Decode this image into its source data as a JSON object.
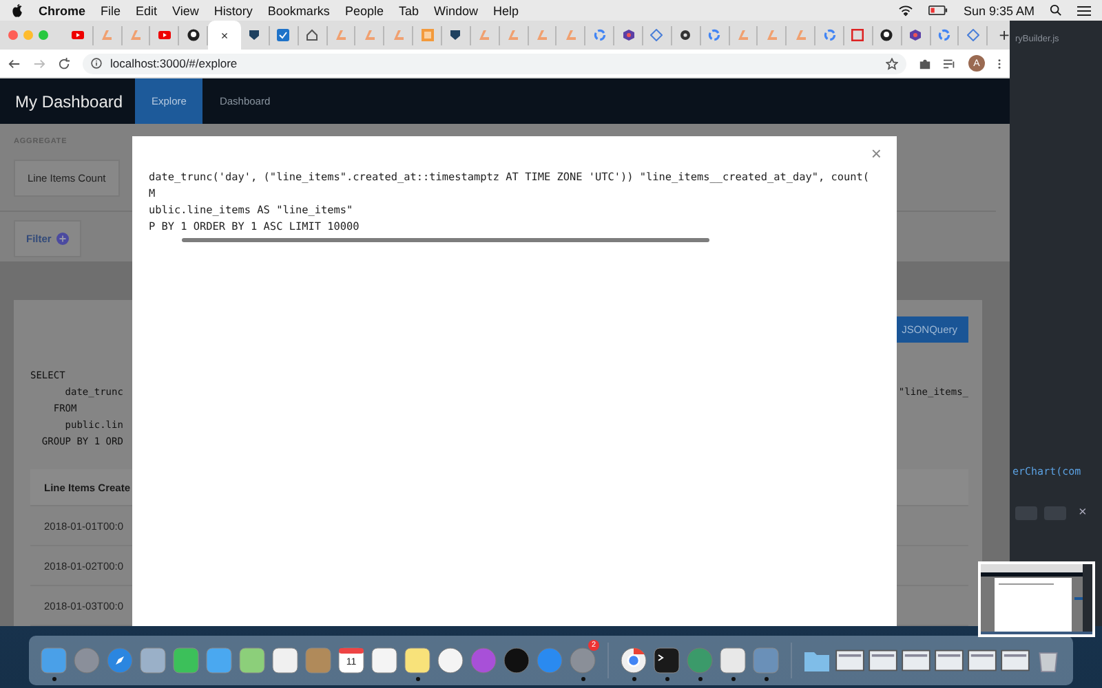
{
  "menu_bar": {
    "app": "Chrome",
    "menus": [
      "File",
      "Edit",
      "View",
      "History",
      "Bookmarks",
      "People",
      "Tab",
      "Window",
      "Help"
    ],
    "clock": "Sun 9:35 AM"
  },
  "browser": {
    "tabs": [
      {
        "kind": "youtube",
        "selected": false
      },
      {
        "kind": "orange",
        "selected": false
      },
      {
        "kind": "orange",
        "selected": false
      },
      {
        "kind": "youtube",
        "selected": false
      },
      {
        "kind": "github",
        "selected": false
      },
      {
        "kind": "blank",
        "selected": true
      },
      {
        "kind": "shield",
        "selected": false
      },
      {
        "kind": "check",
        "selected": false
      },
      {
        "kind": "home",
        "selected": false
      },
      {
        "kind": "orange",
        "selected": false
      },
      {
        "kind": "orange",
        "selected": false
      },
      {
        "kind": "orange",
        "selected": false
      },
      {
        "kind": "grid",
        "selected": false
      },
      {
        "kind": "shield",
        "selected": false
      },
      {
        "kind": "orange",
        "selected": false
      },
      {
        "kind": "orange",
        "selected": false
      },
      {
        "kind": "orange",
        "selected": false
      },
      {
        "kind": "orange",
        "selected": false
      },
      {
        "kind": "google",
        "selected": false
      },
      {
        "kind": "hex",
        "selected": false
      },
      {
        "kind": "diamond",
        "selected": false
      },
      {
        "kind": "gear",
        "selected": false
      },
      {
        "kind": "google",
        "selected": false
      },
      {
        "kind": "orange",
        "selected": false
      },
      {
        "kind": "orange",
        "selected": false
      },
      {
        "kind": "orange",
        "selected": false
      },
      {
        "kind": "google",
        "selected": false
      },
      {
        "kind": "red",
        "selected": false
      },
      {
        "kind": "github",
        "selected": false
      },
      {
        "kind": "hex",
        "selected": false
      },
      {
        "kind": "google",
        "selected": false
      },
      {
        "kind": "diamond",
        "selected": false
      }
    ],
    "tab_close": "×",
    "new_tab": "+",
    "address": "localhost:3000/#/explore",
    "profile_initial": "A"
  },
  "page": {
    "brand": "My Dashboard",
    "nav": [
      {
        "label": "Explore",
        "selected": true
      },
      {
        "label": "Dashboard",
        "selected": false
      }
    ],
    "aggregate_heading": "AGGREGATE",
    "measure_button": "Line Items Count",
    "filter_button": "Filter",
    "query_button": "JSONQuery",
    "sql_lines": [
      "SELECT",
      "      date_trunc",
      "    FROM",
      "      public.lin",
      "  GROUP BY 1 ORD"
    ],
    "sql_right": "\"line_items_",
    "table": {
      "column": "Line Items Create",
      "rows": [
        "2018-01-01T00:0",
        "2018-01-02T00:0",
        "2018-01-03T00:0"
      ]
    }
  },
  "modal": {
    "lines": [
      "date_trunc('day', (\"line_items\".created_at::timestamptz AT TIME ZONE 'UTC')) \"line_items__created_at_day\", count(",
      "M",
      "ublic.line_items AS \"line_items\"",
      "P BY 1 ORDER BY 1 ASC LIMIT 10000"
    ],
    "close": "×"
  },
  "editor": {
    "tab_title": "ryBuilder.js",
    "code": "erChart(com",
    "close": "×"
  },
  "dock": {
    "items": [
      {
        "kind": "finder",
        "running": true
      },
      {
        "kind": "launchpad",
        "running": false
      },
      {
        "kind": "safari",
        "running": false
      },
      {
        "kind": "mail",
        "running": false
      },
      {
        "kind": "facetime",
        "running": false
      },
      {
        "kind": "messages",
        "running": false
      },
      {
        "kind": "maps",
        "running": false
      },
      {
        "kind": "photos",
        "running": false
      },
      {
        "kind": "contacts",
        "running": false
      },
      {
        "kind": "calendar",
        "running": false,
        "label": "11"
      },
      {
        "kind": "reminders",
        "running": false
      },
      {
        "kind": "notes",
        "running": true
      },
      {
        "kind": "music",
        "running": false
      },
      {
        "kind": "podcasts",
        "running": false
      },
      {
        "kind": "tv",
        "running": false
      },
      {
        "kind": "appstore",
        "running": false
      },
      {
        "kind": "settings",
        "running": true,
        "badge": "2"
      },
      {
        "kind": "separator"
      },
      {
        "kind": "chrome",
        "running": true
      },
      {
        "kind": "terminal",
        "running": true
      },
      {
        "kind": "atom",
        "running": true
      },
      {
        "kind": "textedit",
        "running": true
      },
      {
        "kind": "preview",
        "running": true
      },
      {
        "kind": "separator"
      },
      {
        "kind": "folder",
        "running": false
      },
      {
        "kind": "window",
        "running": false
      },
      {
        "kind": "window",
        "running": false
      },
      {
        "kind": "window",
        "running": false
      },
      {
        "kind": "window",
        "running": false
      },
      {
        "kind": "window",
        "running": false
      },
      {
        "kind": "window",
        "running": false
      },
      {
        "kind": "trash",
        "running": false
      }
    ]
  }
}
